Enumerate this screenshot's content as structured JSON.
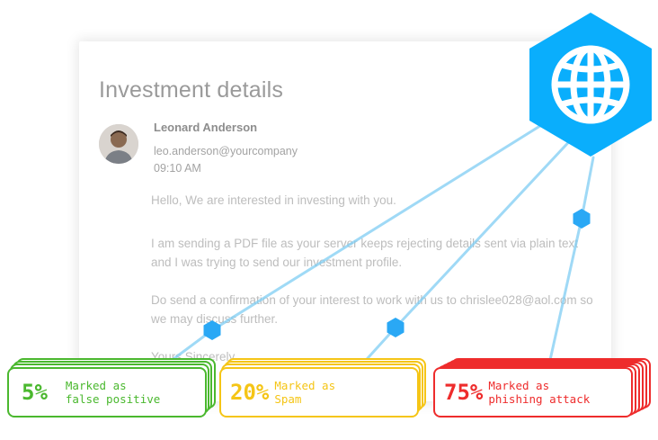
{
  "email": {
    "title": "Investment details",
    "sender_name": "Leonard Anderson",
    "sender_email": "leo.anderson@yourcompany",
    "time": "09:10 AM",
    "paragraphs": [
      "Hello, We are interested in investing with you.",
      "I am sending a PDF file as your server keeps rejecting details sent via plain text and I was trying to send our investment profile.",
      "Do send a confirmation of your interest to work with us to chrislee028@aol.com so we may discuss further.",
      "Yours Sincerely,"
    ]
  },
  "globe": {
    "icon": "globe-icon",
    "color": "#0aaefc"
  },
  "stats": [
    {
      "percent": "5%",
      "line1": "Marked as",
      "line2": "false positive",
      "color": "#4ab82e"
    },
    {
      "percent": "20%",
      "line1": "Marked as",
      "line2": "Spam",
      "color": "#f5c516"
    },
    {
      "percent": "75%",
      "line1": "Marked as",
      "line2": "phishing attack",
      "color": "#ee2c2c"
    }
  ]
}
